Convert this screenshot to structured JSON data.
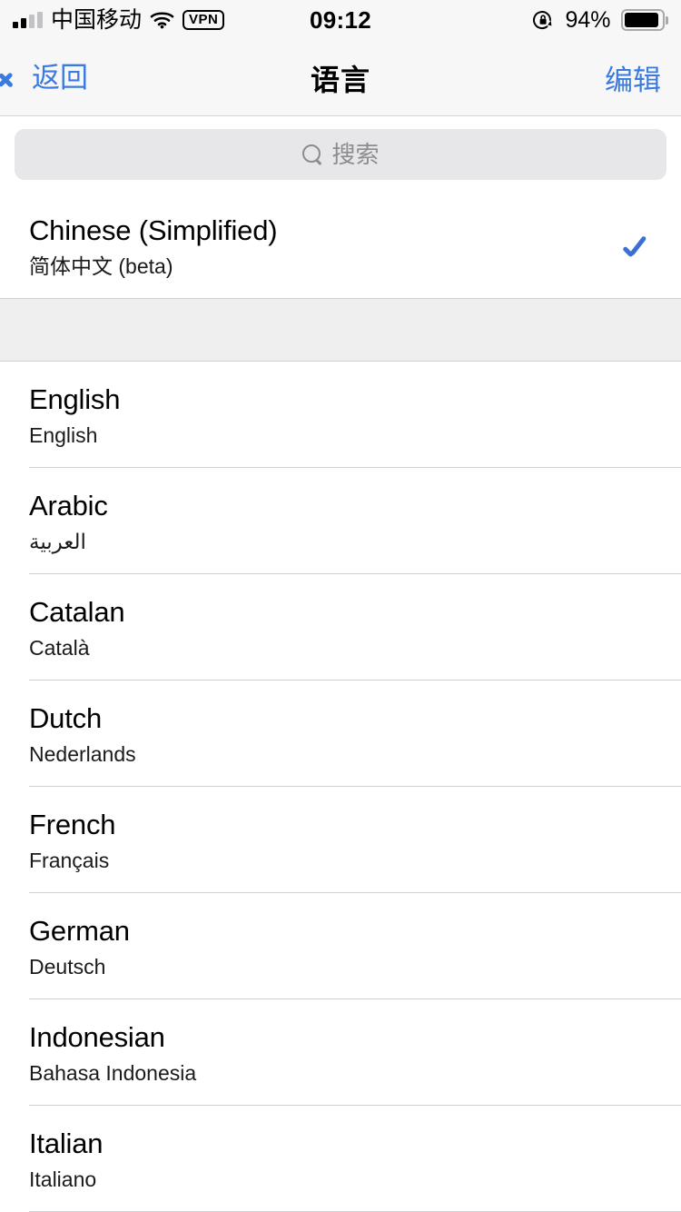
{
  "status_bar": {
    "carrier": "中国移动",
    "wifi_icon": "wifi-icon",
    "vpn_label": "VPN",
    "time": "09:12",
    "rotation_lock_icon": "rotation-lock-icon",
    "battery_percent": "94%",
    "battery_level": 94
  },
  "nav": {
    "back_icon": "chevron-left-icon",
    "back_label": "返回",
    "title": "语言",
    "edit_label": "编辑",
    "accent_color": "#3b7ae0"
  },
  "search": {
    "icon": "search-icon",
    "placeholder": "搜索",
    "value": ""
  },
  "selected_section": {
    "rows": [
      {
        "title": "Chinese (Simplified)",
        "subtitle": "简体中文 (beta)",
        "selected": true,
        "check_icon": "checkmark-icon",
        "check_color": "#3b6fd4"
      }
    ]
  },
  "language_list": {
    "rows": [
      {
        "title": "English",
        "subtitle": "English",
        "selected": false,
        "rtl": false
      },
      {
        "title": "Arabic",
        "subtitle": "العربية",
        "selected": false,
        "rtl": true
      },
      {
        "title": "Catalan",
        "subtitle": "Català",
        "selected": false,
        "rtl": false
      },
      {
        "title": "Dutch",
        "subtitle": "Nederlands",
        "selected": false,
        "rtl": false
      },
      {
        "title": "French",
        "subtitle": "Français",
        "selected": false,
        "rtl": false
      },
      {
        "title": "German",
        "subtitle": "Deutsch",
        "selected": false,
        "rtl": false
      },
      {
        "title": "Indonesian",
        "subtitle": "Bahasa Indonesia",
        "selected": false,
        "rtl": false
      },
      {
        "title": "Italian",
        "subtitle": "Italiano",
        "selected": false,
        "rtl": false
      }
    ]
  }
}
